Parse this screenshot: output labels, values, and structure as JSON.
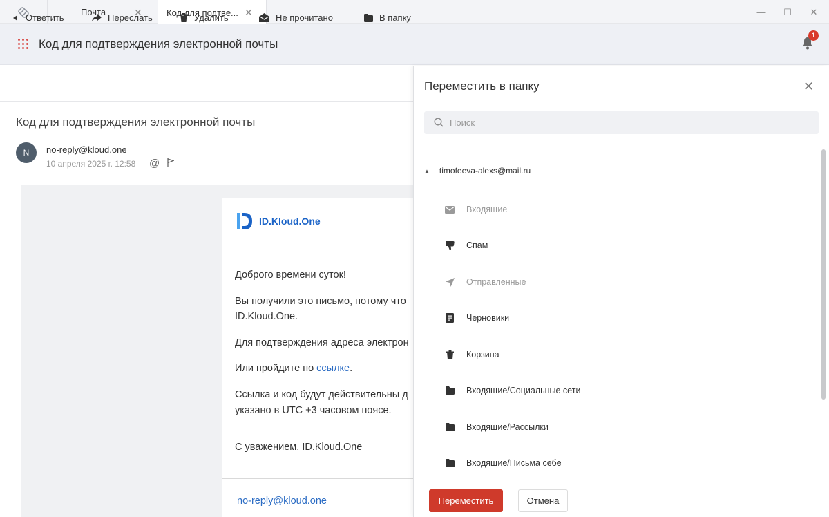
{
  "window": {
    "tabs": [
      {
        "label": "Почта",
        "close": "✕"
      },
      {
        "label": "Код для подтве...",
        "close": "✕"
      }
    ],
    "controls": {
      "minimize": "—",
      "maximize": "☐",
      "close": "✕"
    }
  },
  "header": {
    "title": "Код для подтверждения электронной почты",
    "notification_count": "1"
  },
  "toolbar": {
    "reply": "Ответить",
    "forward": "Переслать",
    "delete": "Удалить",
    "unread": "Не прочитано",
    "to_folder": "В папку"
  },
  "message": {
    "subject": "Код для подтверждения электронной почты",
    "avatar_letter": "N",
    "sender": "no-reply@kloud.one",
    "date": "10 апреля 2025 г. 12:58",
    "at_symbol": "@"
  },
  "mail_body": {
    "brand": "ID.Kloud.One",
    "greeting": "Доброго времени суток!",
    "para1_line1": "Вы получили это письмо, потому что",
    "para1_line2": "ID.Kloud.One.",
    "para2": "Для подтверждения адреса электрон",
    "para3_prefix": "Или пройдите по ",
    "para3_link": "ссылке",
    "para3_suffix": ".",
    "para4_line1": "Ссылка и код будут действительны д",
    "para4_line2": "указано в UTC +3 часовом поясе.",
    "signature": "С уважением, ID.Kloud.One",
    "footer_link": "no-reply@kloud.one"
  },
  "move_panel": {
    "title": "Переместить в папку",
    "close": "✕",
    "search_placeholder": "Поиск",
    "account": "timofeeva-alexs@mail.ru",
    "folders": [
      {
        "label": "Входящие",
        "icon": "envelope-icon",
        "disabled": true
      },
      {
        "label": "Спам",
        "icon": "thumbs-down-icon",
        "disabled": false
      },
      {
        "label": "Отправленные",
        "icon": "paper-plane-icon",
        "disabled": true
      },
      {
        "label": "Черновики",
        "icon": "draft-icon",
        "disabled": false
      },
      {
        "label": "Корзина",
        "icon": "trash-icon",
        "disabled": false
      },
      {
        "label": "Входящие/Социальные сети",
        "icon": "folder-icon",
        "disabled": false
      },
      {
        "label": "Входящие/Рассылки",
        "icon": "folder-icon",
        "disabled": false
      },
      {
        "label": "Входящие/Письма себе",
        "icon": "folder-icon",
        "disabled": false
      }
    ],
    "move_button": "Переместить",
    "cancel_button": "Отмена"
  },
  "colors": {
    "accent": "#cf3a2b",
    "link": "#2b6cc4",
    "brand": "#1a63c7"
  }
}
